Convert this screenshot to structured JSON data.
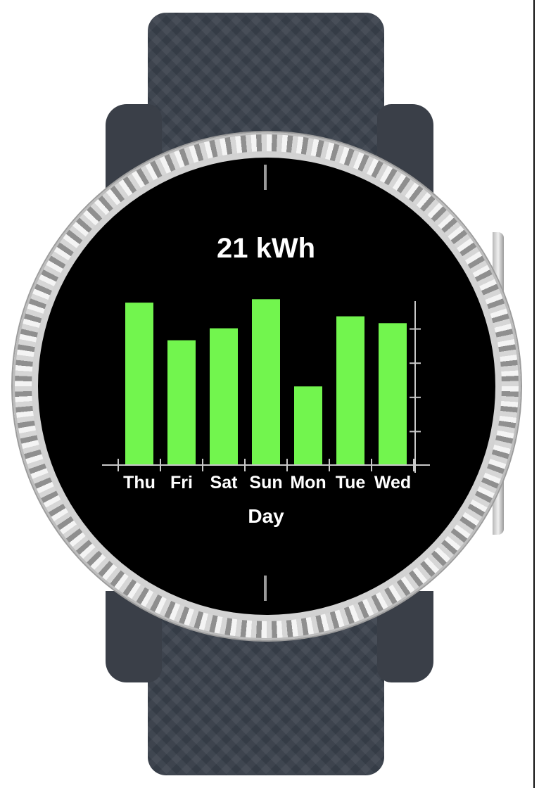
{
  "watch": {
    "title": "21 kWh",
    "x_axis_label": "Day"
  },
  "colors": {
    "bar": "#72f54e",
    "axis": "#c8c8c8",
    "screen": "#000000",
    "strap": "#3b424d"
  },
  "chart_data": {
    "type": "bar",
    "title": "21 kWh",
    "xlabel": "Day",
    "ylabel": "",
    "categories": [
      "Thu",
      "Fri",
      "Sat",
      "Sun",
      "Mon",
      "Tue",
      "Wed"
    ],
    "values": [
      95,
      73,
      80,
      97,
      46,
      87,
      83
    ],
    "ylim": [
      0,
      100
    ],
    "ytick_count": 4,
    "y_axis_side": "right",
    "grid": false,
    "legend": "none"
  }
}
